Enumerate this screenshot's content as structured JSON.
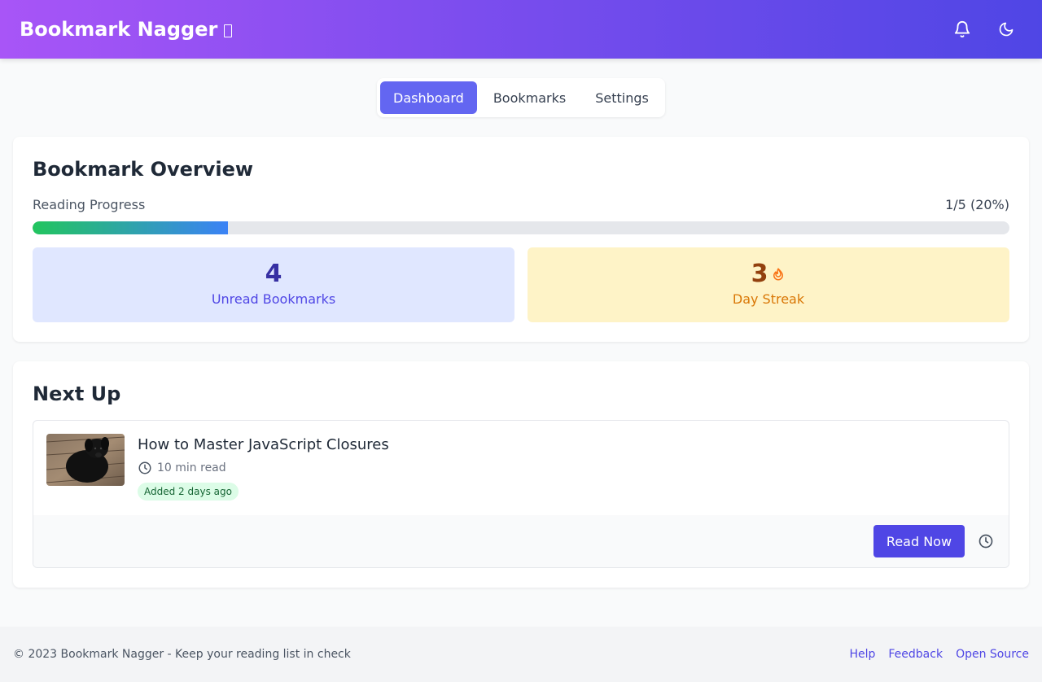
{
  "header": {
    "brand": "Bookmark Nagger",
    "icons": [
      "bell-icon",
      "moon-icon"
    ],
    "gradient": [
      "#a855f7",
      "#4f46e5"
    ]
  },
  "tabs": [
    {
      "label": "Dashboard",
      "active": true
    },
    {
      "label": "Bookmarks",
      "active": false
    },
    {
      "label": "Settings",
      "active": false
    }
  ],
  "overview": {
    "title": "Bookmark Overview",
    "progress_label": "Reading Progress",
    "progress_value": "1/5 (20%)",
    "progress_fraction": 0.2,
    "unread": {
      "value": "4",
      "label": "Unread Bookmarks"
    },
    "streak": {
      "value": "3",
      "label": "Day Streak",
      "icon": "flame-icon"
    }
  },
  "next_up": {
    "title": "Next Up",
    "item": {
      "title": "How to Master JavaScript Closures",
      "read_time": "10 min read",
      "added": "Added 2 days ago",
      "thumbnail": "black-dog-photo",
      "read_button": "Read Now",
      "snooze_icon": "clock-icon"
    }
  },
  "footer": {
    "copyright": "© 2023 Bookmark Nagger - Keep your reading list in check",
    "links": [
      "Help",
      "Feedback",
      "Open Source"
    ]
  },
  "colors": {
    "accent": "#4f46e5",
    "tab_active": "#6366f1",
    "unread_bg": "#e0e7ff",
    "streak_bg": "#fef3c7",
    "badge_bg": "#dcfce7"
  }
}
